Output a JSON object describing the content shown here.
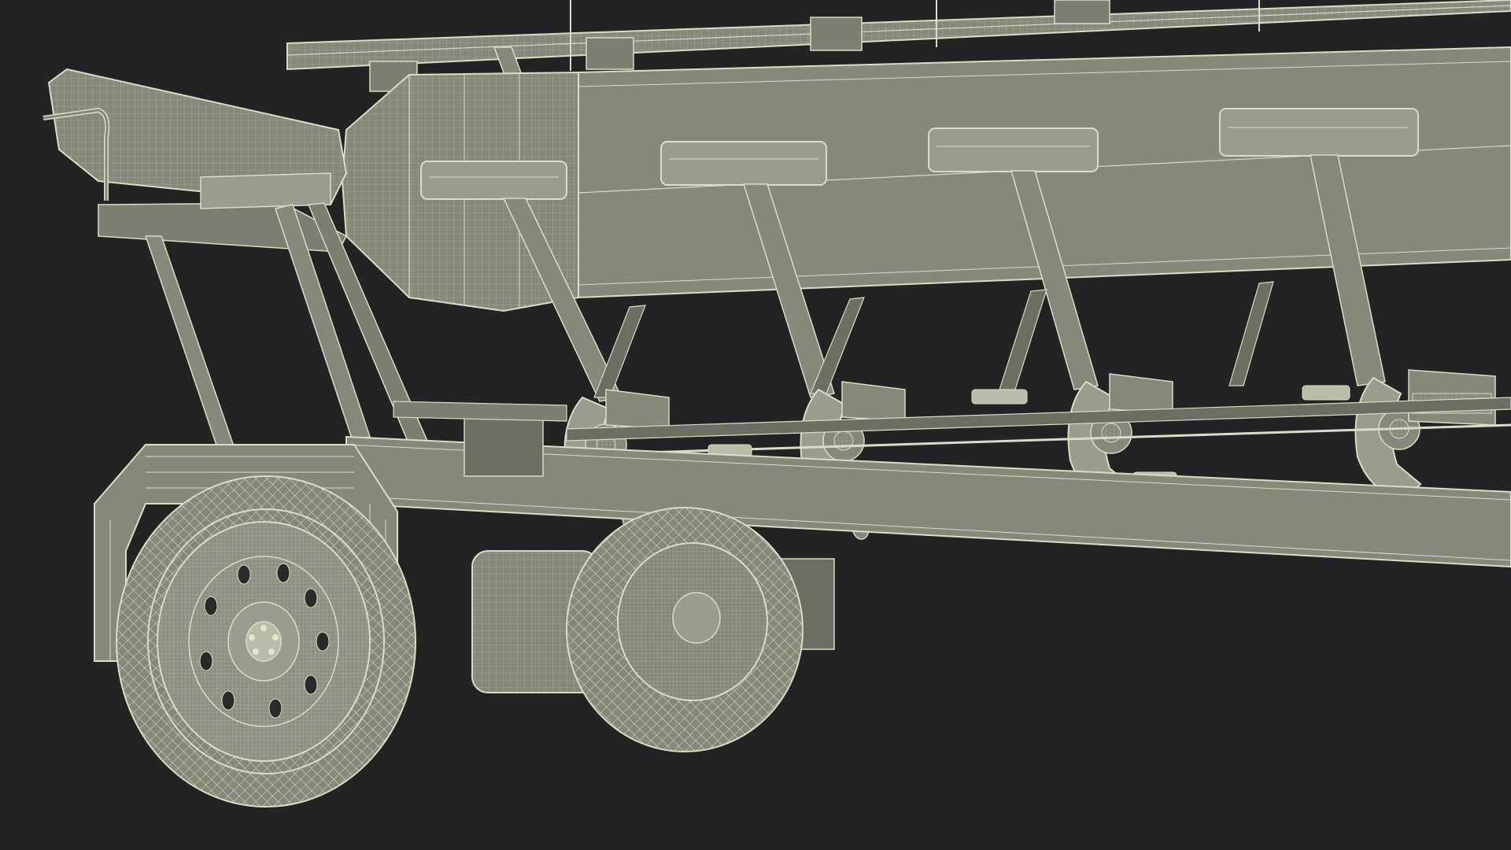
{
  "scene": {
    "subject": "pedal-bike-wireframe",
    "background_color": "#232323",
    "model_fill": "#86887a",
    "model_fill_light": "#9a9c8d",
    "model_fill_dark": "#6c6e62",
    "wire_color": "#d9dcc6",
    "wire_faint": "#b9bca8",
    "view": "perspective-wireframe-render",
    "seat_count": 4,
    "wheel_count": 2
  }
}
